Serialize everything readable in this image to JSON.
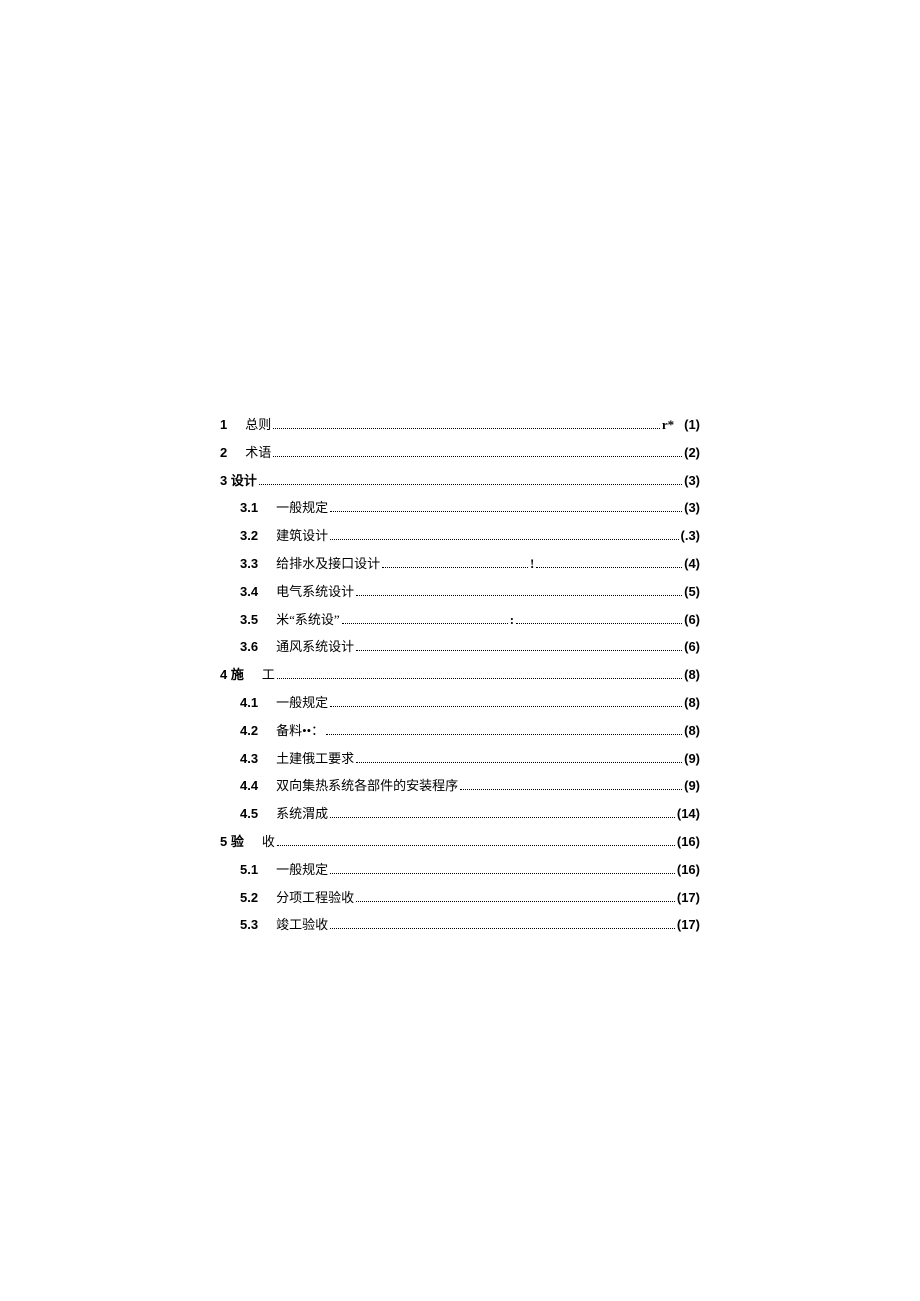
{
  "toc": [
    {
      "level": "main",
      "num": "1",
      "label": "总则",
      "trail": "r*",
      "page": "(1)"
    },
    {
      "level": "main",
      "num": "2",
      "label": "术语",
      "trail": "",
      "page": "(2)"
    },
    {
      "level": "main",
      "num": "3 设计",
      "label": "",
      "trail": "",
      "page": "(3)"
    },
    {
      "level": "sub",
      "num": "3.1",
      "label": "一般规定",
      "trail": "",
      "page": "(3)"
    },
    {
      "level": "sub",
      "num": "3.2",
      "label": "建筑设计",
      "trail": "",
      "page": "(.3)"
    },
    {
      "level": "sub",
      "num": "3.3",
      "label": "给排水及接口设计",
      "trail": "!",
      "page": "(4)"
    },
    {
      "level": "sub",
      "num": "3.4",
      "label": "电气系统设计",
      "trail": "",
      "page": "(5)"
    },
    {
      "level": "sub",
      "num": "3.5",
      "label": "米“系统设”",
      "trail": ":",
      "page": "(6)"
    },
    {
      "level": "sub",
      "num": "3.6",
      "label": "通风系统设计",
      "trail": "",
      "page": "(6)"
    },
    {
      "level": "main",
      "num": "4 施",
      "label": "工",
      "trail": "",
      "page": "(8)"
    },
    {
      "level": "sub",
      "num": "4.1",
      "label": "一般规定",
      "trail": "",
      "page": "(8)"
    },
    {
      "level": "sub",
      "num": "4.2",
      "label": "备料••：",
      "trail": "",
      "page": "(8)"
    },
    {
      "level": "sub",
      "num": "4.3",
      "label": "土建俄工要求",
      "trail": "",
      "page": "(9)"
    },
    {
      "level": "sub",
      "num": "4.4",
      "label": "双向集热系统各部件的安装程序",
      "trail": "",
      "page": "(9)"
    },
    {
      "level": "sub",
      "num": "4.5",
      "label": "系统渭成",
      "trail": "",
      "page": "(14)"
    },
    {
      "level": "main",
      "num": "5 验",
      "label": "收",
      "trail": "",
      "page": "(16)"
    },
    {
      "level": "sub",
      "num": "5.1",
      "label": "一般规定",
      "trail": "",
      "page": "(16)"
    },
    {
      "level": "sub",
      "num": "5.2",
      "label": "分项工程验收",
      "trail": "",
      "page": "(17)"
    },
    {
      "level": "sub",
      "num": "5.3",
      "label": "竣工验收",
      "trail": "",
      "page": "(17)"
    }
  ]
}
